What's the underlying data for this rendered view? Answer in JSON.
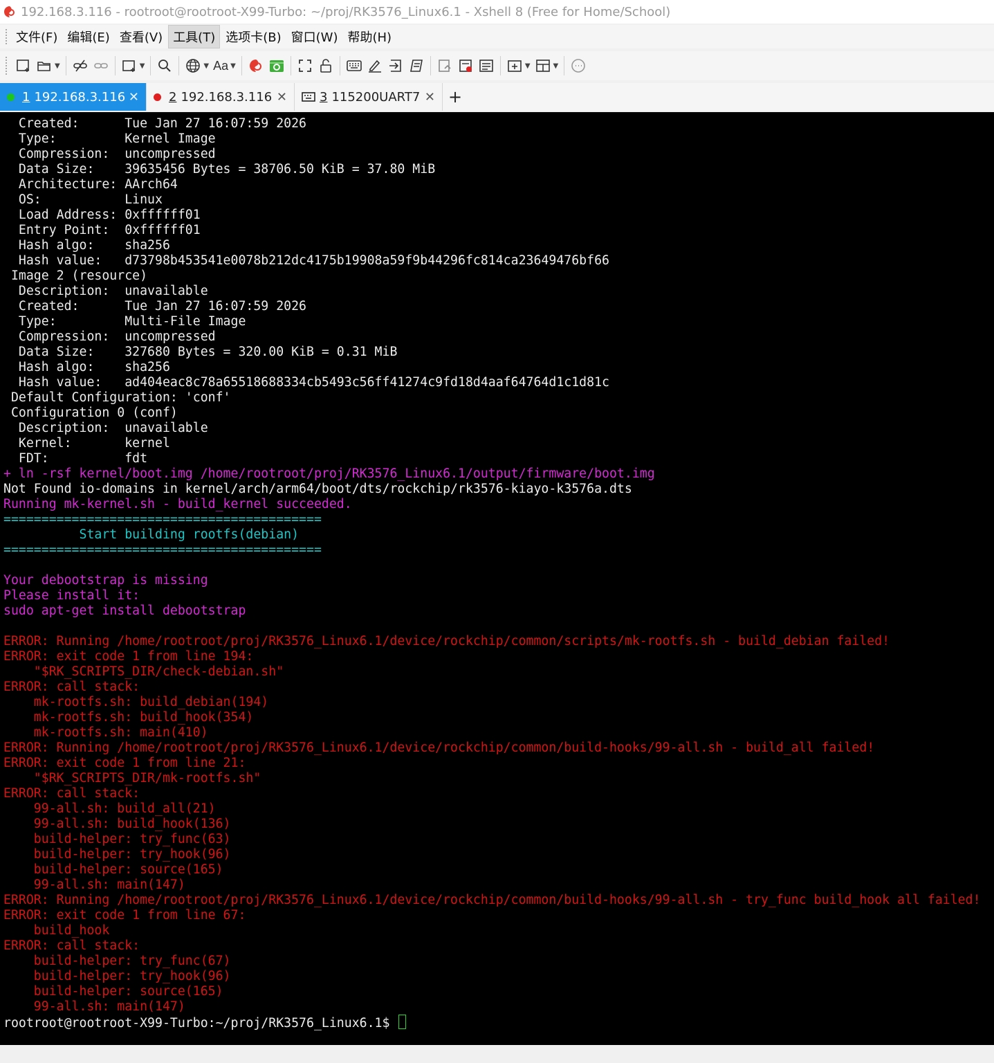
{
  "window": {
    "title": "192.168.3.116 - rootroot@rootroot-X99-Turbo: ~/proj/RK3576_Linux6.1 - Xshell 8 (Free for Home/School)"
  },
  "menu": [
    "文件(F)",
    "编辑(E)",
    "查看(V)",
    "工具(T)",
    "选项卡(B)",
    "窗口(W)",
    "帮助(H)"
  ],
  "menu_active_index": 3,
  "toolbar": {
    "font_button_label": "Aa",
    "icons": [
      "new-session-icon",
      "open-folder-icon",
      "disconnect-icon",
      "reconnect-icon",
      "new-window-icon",
      "find-icon",
      "globe-icon",
      "font-icon",
      "xshell-icon",
      "xftp-icon",
      "fullscreen-icon",
      "lock-icon",
      "keyboard-icon",
      "highlight-icon",
      "transfer-icon",
      "script-icon",
      "log-icon",
      "record-icon",
      "compose-icon",
      "new-tab-icon",
      "layout-icon",
      "chat-icon"
    ]
  },
  "tabs": [
    {
      "number": "1",
      "label": "192.168.3.116",
      "status_color": "#1ec51e",
      "active": true
    },
    {
      "number": "2",
      "label": "192.168.3.116",
      "status_color": "#e02020",
      "active": false
    },
    {
      "number": "3",
      "label": "115200UART7",
      "icon": "serial-port-icon",
      "active": false
    }
  ],
  "new_tab_label": "+",
  "colors": {
    "white": "#ececec",
    "magenta": "#d22bd2",
    "cyan": "#1fc6c6",
    "red": "#d01515",
    "cursor": "#2ad42a",
    "active_tab": "#1e90e6"
  },
  "terminal": {
    "lines": [
      {
        "text": "  Created:      Tue Jan 27 16:07:59 2026",
        "color": "white"
      },
      {
        "text": "  Type:         Kernel Image",
        "color": "white"
      },
      {
        "text": "  Compression:  uncompressed",
        "color": "white"
      },
      {
        "text": "  Data Size:    39635456 Bytes = 38706.50 KiB = 37.80 MiB",
        "color": "white"
      },
      {
        "text": "  Architecture: AArch64",
        "color": "white"
      },
      {
        "text": "  OS:           Linux",
        "color": "white"
      },
      {
        "text": "  Load Address: 0xffffff01",
        "color": "white"
      },
      {
        "text": "  Entry Point:  0xffffff01",
        "color": "white"
      },
      {
        "text": "  Hash algo:    sha256",
        "color": "white"
      },
      {
        "text": "  Hash value:   d73798b453541e0078b212dc4175b19908a59f9b44296fc814ca23649476bf66",
        "color": "white"
      },
      {
        "text": " Image 2 (resource)",
        "color": "white"
      },
      {
        "text": "  Description:  unavailable",
        "color": "white"
      },
      {
        "text": "  Created:      Tue Jan 27 16:07:59 2026",
        "color": "white"
      },
      {
        "text": "  Type:         Multi-File Image",
        "color": "white"
      },
      {
        "text": "  Compression:  uncompressed",
        "color": "white"
      },
      {
        "text": "  Data Size:    327680 Bytes = 320.00 KiB = 0.31 MiB",
        "color": "white"
      },
      {
        "text": "  Hash algo:    sha256",
        "color": "white"
      },
      {
        "text": "  Hash value:   ad404eac8c78a65518688334cb5493c56ff41274c9fd18d4aaf64764d1c1d81c",
        "color": "white"
      },
      {
        "text": " Default Configuration: 'conf'",
        "color": "white"
      },
      {
        "text": " Configuration 0 (conf)",
        "color": "white"
      },
      {
        "text": "  Description:  unavailable",
        "color": "white"
      },
      {
        "text": "  Kernel:       kernel",
        "color": "white"
      },
      {
        "text": "  FDT:          fdt",
        "color": "white"
      },
      {
        "text": "+ ln -rsf kernel/boot.img /home/rootroot/proj/RK3576_Linux6.1/output/firmware/boot.img",
        "color": "magenta"
      },
      {
        "text": "Not Found io-domains in kernel/arch/arm64/boot/dts/rockchip/rk3576-kiayo-k3576a.dts",
        "color": "white"
      },
      {
        "text": "Running mk-kernel.sh - build_kernel succeeded.",
        "color": "magenta"
      },
      {
        "text": "==========================================",
        "color": "cyan"
      },
      {
        "text": "          Start building rootfs(debian)",
        "color": "cyan"
      },
      {
        "text": "==========================================",
        "color": "cyan"
      },
      {
        "text": "",
        "color": "white"
      },
      {
        "text": "Your debootstrap is missing",
        "color": "magenta"
      },
      {
        "text": "Please install it:",
        "color": "magenta"
      },
      {
        "text": "sudo apt-get install debootstrap",
        "color": "magenta"
      },
      {
        "text": "",
        "color": "white"
      },
      {
        "text": "ERROR: Running /home/rootroot/proj/RK3576_Linux6.1/device/rockchip/common/scripts/mk-rootfs.sh - build_debian failed!",
        "color": "red"
      },
      {
        "text": "ERROR: exit code 1 from line 194:",
        "color": "red"
      },
      {
        "text": "    \"$RK_SCRIPTS_DIR/check-debian.sh\"",
        "color": "red"
      },
      {
        "text": "ERROR: call stack:",
        "color": "red"
      },
      {
        "text": "    mk-rootfs.sh: build_debian(194)",
        "color": "red"
      },
      {
        "text": "    mk-rootfs.sh: build_hook(354)",
        "color": "red"
      },
      {
        "text": "    mk-rootfs.sh: main(410)",
        "color": "red"
      },
      {
        "text": "ERROR: Running /home/rootroot/proj/RK3576_Linux6.1/device/rockchip/common/build-hooks/99-all.sh - build_all failed!",
        "color": "red"
      },
      {
        "text": "ERROR: exit code 1 from line 21:",
        "color": "red"
      },
      {
        "text": "    \"$RK_SCRIPTS_DIR/mk-rootfs.sh\"",
        "color": "red"
      },
      {
        "text": "ERROR: call stack:",
        "color": "red"
      },
      {
        "text": "    99-all.sh: build_all(21)",
        "color": "red"
      },
      {
        "text": "    99-all.sh: build_hook(136)",
        "color": "red"
      },
      {
        "text": "    build-helper: try_func(63)",
        "color": "red"
      },
      {
        "text": "    build-helper: try_hook(96)",
        "color": "red"
      },
      {
        "text": "    build-helper: source(165)",
        "color": "red"
      },
      {
        "text": "    99-all.sh: main(147)",
        "color": "red"
      },
      {
        "text": "ERROR: Running /home/rootroot/proj/RK3576_Linux6.1/device/rockchip/common/build-hooks/99-all.sh - try_func build_hook all failed!",
        "color": "red"
      },
      {
        "text": "ERROR: exit code 1 from line 67:",
        "color": "red"
      },
      {
        "text": "    build_hook",
        "color": "red"
      },
      {
        "text": "ERROR: call stack:",
        "color": "red"
      },
      {
        "text": "    build-helper: try_func(67)",
        "color": "red"
      },
      {
        "text": "    build-helper: try_hook(96)",
        "color": "red"
      },
      {
        "text": "    build-helper: source(165)",
        "color": "red"
      },
      {
        "text": "    99-all.sh: main(147)",
        "color": "red"
      }
    ],
    "prompt": "rootroot@rootroot-X99-Turbo:~/proj/RK3576_Linux6.1$ "
  }
}
